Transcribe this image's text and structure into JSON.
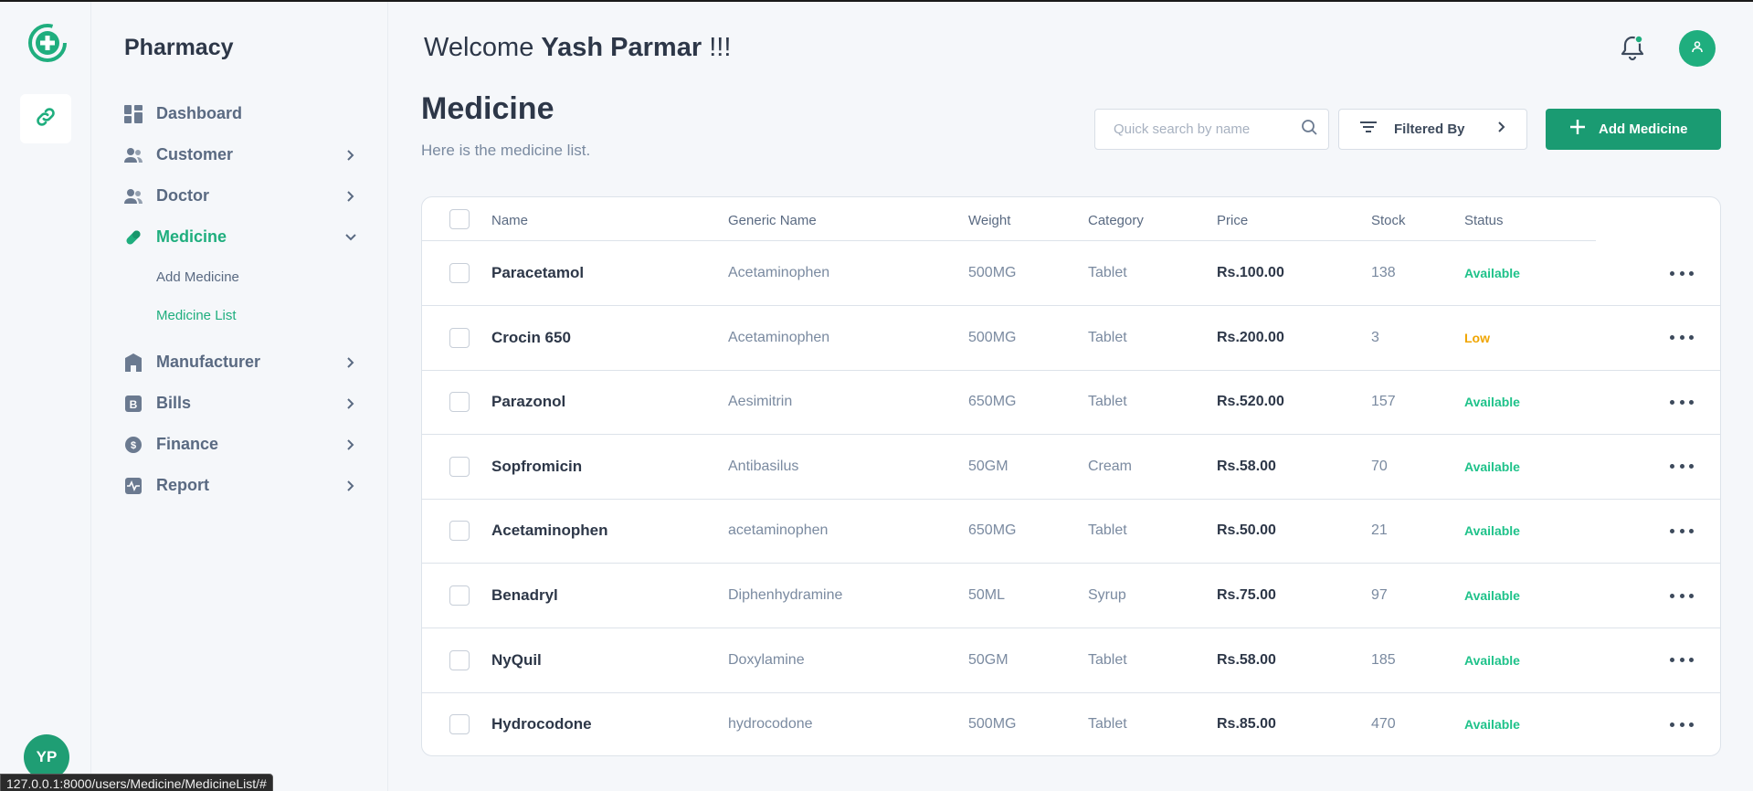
{
  "rail": {
    "avatar_initials": "YP"
  },
  "sidebar": {
    "brand": "Pharmacy",
    "items": [
      {
        "label": "Dashboard",
        "icon": "dashboard-icon"
      },
      {
        "label": "Customer",
        "icon": "users-icon"
      },
      {
        "label": "Doctor",
        "icon": "users-icon"
      },
      {
        "label": "Medicine",
        "icon": "pill-icon",
        "active": true
      },
      {
        "label": "Manufacturer",
        "icon": "building-icon"
      },
      {
        "label": "Bills",
        "icon": "bill-icon"
      },
      {
        "label": "Finance",
        "icon": "dollar-icon"
      },
      {
        "label": "Report",
        "icon": "activity-icon"
      }
    ],
    "medicine_sub": [
      {
        "label": "Add Medicine"
      },
      {
        "label": "Medicine List",
        "active": true
      }
    ]
  },
  "header": {
    "welcome_prefix": "Welcome",
    "user_name": "Yash Parmar",
    "welcome_suffix": "!!!"
  },
  "page": {
    "title": "Medicine",
    "subtitle": "Here is the medicine list."
  },
  "toolbar": {
    "search_placeholder": "Quick search by name",
    "filter_label": "Filtered By",
    "add_label": "Add Medicine"
  },
  "table": {
    "columns": [
      "Name",
      "Generic Name",
      "Weight",
      "Category",
      "Price",
      "Stock",
      "Status"
    ],
    "rows": [
      {
        "name": "Paracetamol",
        "generic": "Acetaminophen",
        "weight": "500MG",
        "category": "Tablet",
        "price": "Rs.100.00",
        "stock": "138",
        "status": "Available"
      },
      {
        "name": "Crocin 650",
        "generic": "Acetaminophen",
        "weight": "500MG",
        "category": "Tablet",
        "price": "Rs.200.00",
        "stock": "3",
        "status": "Low"
      },
      {
        "name": "Parazonol",
        "generic": "Aesimitrin",
        "weight": "650MG",
        "category": "Tablet",
        "price": "Rs.520.00",
        "stock": "157",
        "status": "Available"
      },
      {
        "name": "Sopfromicin",
        "generic": "Antibasilus",
        "weight": "50GM",
        "category": "Cream",
        "price": "Rs.58.00",
        "stock": "70",
        "status": "Available"
      },
      {
        "name": "Acetaminophen",
        "generic": "acetaminophen",
        "weight": "650MG",
        "category": "Tablet",
        "price": "Rs.50.00",
        "stock": "21",
        "status": "Available"
      },
      {
        "name": "Benadryl",
        "generic": "Diphenhydramine",
        "weight": "50ML",
        "category": "Syrup",
        "price": "Rs.75.00",
        "stock": "97",
        "status": "Available"
      },
      {
        "name": "NyQuil",
        "generic": "Doxylamine",
        "weight": "50GM",
        "category": "Tablet",
        "price": "Rs.58.00",
        "stock": "185",
        "status": "Available"
      },
      {
        "name": "Hydrocodone",
        "generic": "hydrocodone",
        "weight": "500MG",
        "category": "Tablet",
        "price": "Rs.85.00",
        "stock": "470",
        "status": "Available"
      }
    ]
  },
  "colors": {
    "accent": "#1fae7e",
    "available": "#1fc28a",
    "low": "#f0a500"
  },
  "browser": {
    "status_url": "127.0.0.1:8000/users/Medicine/MedicineList/#"
  }
}
